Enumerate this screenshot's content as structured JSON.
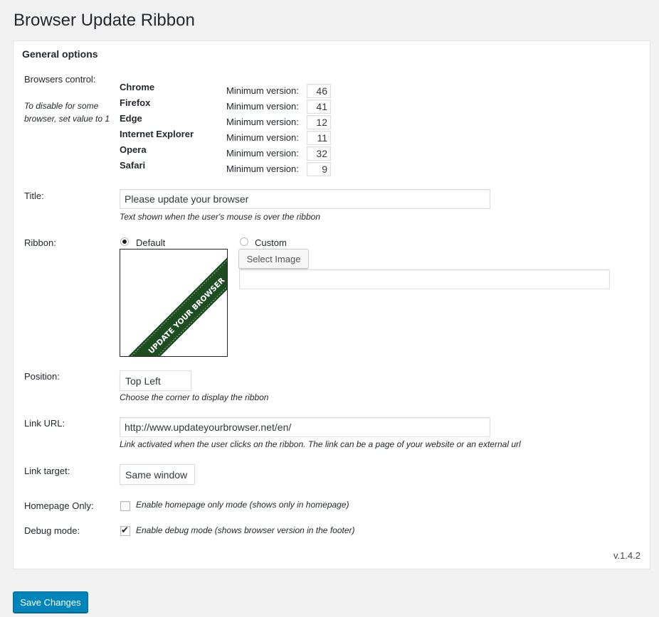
{
  "page_title": "Browser Update Ribbon",
  "section_title": "General options",
  "browsers_control": {
    "label": "Browsers control:",
    "note": "To disable for some browser, set value to 1",
    "min_label": "Minimum version:",
    "browsers": [
      {
        "name": "Chrome",
        "version": "46"
      },
      {
        "name": "Firefox",
        "version": "41"
      },
      {
        "name": "Edge",
        "version": "12"
      },
      {
        "name": "Internet Explorer",
        "version": "11"
      },
      {
        "name": "Opera",
        "version": "32"
      },
      {
        "name": "Safari",
        "version": "9"
      }
    ]
  },
  "title_field": {
    "label": "Title:",
    "value": "Please update your browser",
    "description": "Text shown when the user's mouse is over the ribbon"
  },
  "ribbon": {
    "label": "Ribbon:",
    "default_label": "Default",
    "custom_label": "Custom",
    "selected": "Default",
    "ribbon_text": "UPDATE YOUR BROWSER",
    "select_image_label": "Select Image",
    "custom_url_value": ""
  },
  "position": {
    "label": "Position:",
    "value": "Top Left",
    "description": "Choose the corner to display the ribbon"
  },
  "link_url": {
    "label": "Link URL:",
    "value": "http://www.updateyourbrowser.net/en/",
    "description": "Link activated when the user clicks on the ribbon. The link can be a page of your website or an external url"
  },
  "link_target": {
    "label": "Link target:",
    "value": "Same window"
  },
  "homepage_only": {
    "label": "Homepage Only:",
    "checkbox_label": "Enable homepage only mode (shows only in homepage)",
    "checked": false
  },
  "debug_mode": {
    "label": "Debug mode:",
    "checkbox_label": "Enable debug mode (shows browser version in the footer)",
    "checked": true
  },
  "version": "v.1.4.2",
  "save_label": "Save Changes",
  "colors": {
    "primary_button": "#0085ba",
    "ribbon_green": "#1f4d22"
  }
}
